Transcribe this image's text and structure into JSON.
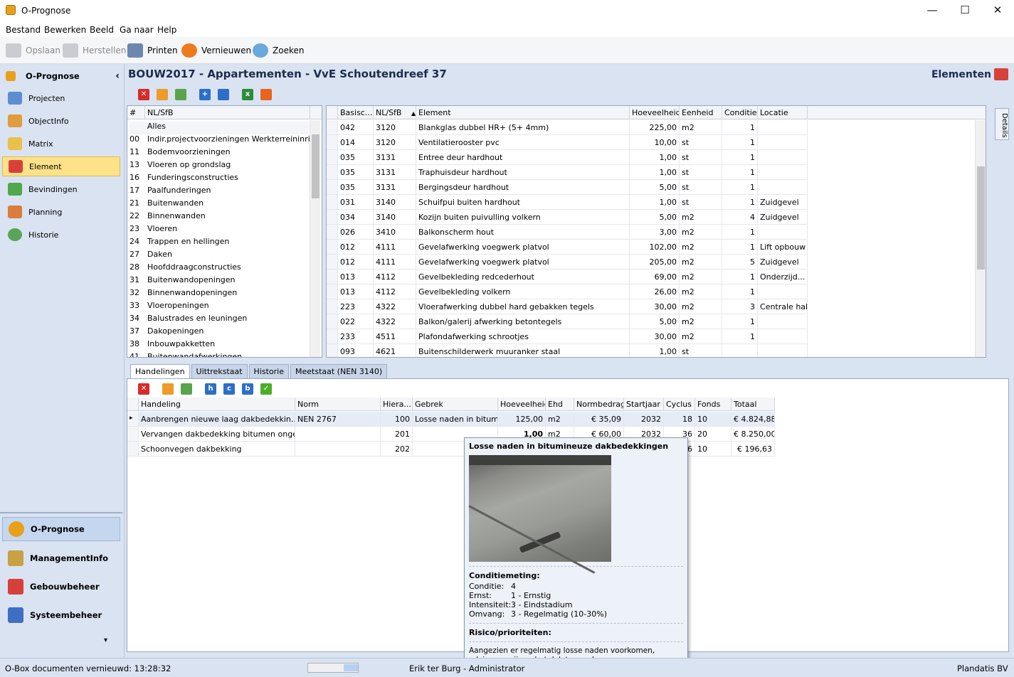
{
  "window": {
    "title": "O-Prognose",
    "min": "—",
    "max": "☐",
    "close": "✕"
  },
  "menu": [
    "Bestand",
    "Bewerken",
    "Beeld",
    "Ga naar",
    "Help"
  ],
  "toolbar": {
    "save": "Opslaan",
    "restore": "Herstellen",
    "print": "Printen",
    "refresh": "Vernieuwen",
    "search": "Zoeken"
  },
  "sidebar": {
    "header": "O-Prognose",
    "collapse": "‹",
    "items": [
      "Projecten",
      "ObjectInfo",
      "Matrix",
      "Element",
      "Bevindingen",
      "Planning",
      "Historie"
    ],
    "selected": "Element",
    "modules": [
      "O-Prognose",
      "ManagementInfo",
      "Gebouwbeheer",
      "Systeembeheer"
    ],
    "more": "▾"
  },
  "page": {
    "title": "BOUW2017 - Appartementen - VvE Schoutendreef 37",
    "section": "Elementen"
  },
  "nlsfb": {
    "headers": [
      "#",
      "NL/SfB"
    ],
    "rows": [
      [
        "",
        "Alles"
      ],
      [
        "00",
        "Indir.projectvoorzieningen Werkterreininrich..."
      ],
      [
        "11",
        "Bodemvoorzieningen"
      ],
      [
        "13",
        "Vloeren op grondslag"
      ],
      [
        "16",
        "Funderingsconstructies"
      ],
      [
        "17",
        "Paalfunderingen"
      ],
      [
        "21",
        "Buitenwanden"
      ],
      [
        "22",
        "Binnenwanden"
      ],
      [
        "23",
        "Vloeren"
      ],
      [
        "24",
        "Trappen en hellingen"
      ],
      [
        "27",
        "Daken"
      ],
      [
        "28",
        "Hoofddraagconstructies"
      ],
      [
        "31",
        "Buitenwandopeningen"
      ],
      [
        "32",
        "Binnenwandopeningen"
      ],
      [
        "33",
        "Vloeropeningen"
      ],
      [
        "34",
        "Balustrades en leuningen"
      ],
      [
        "37",
        "Dakopeningen"
      ],
      [
        "38",
        "Inbouwpakketten"
      ],
      [
        "41",
        "Buitenwandafwerkingen"
      ]
    ]
  },
  "elements": {
    "headers": [
      "Basisc...",
      "NL/SfB",
      "Element",
      "Hoeveelheid",
      "Eenheid",
      "Conditie",
      "Locatie"
    ],
    "sort_indicator": "▲",
    "rows": [
      [
        "042",
        "3120",
        "Blankglas dubbel HR+ (5+ 4mm)",
        "225,00",
        "m2",
        "1",
        ""
      ],
      [
        "014",
        "3120",
        "Ventilatierooster pvc",
        "10,00",
        "st",
        "1",
        ""
      ],
      [
        "035",
        "3131",
        "Entree deur hardhout",
        "1,00",
        "st",
        "1",
        ""
      ],
      [
        "035",
        "3131",
        "Traphuisdeur hardhout",
        "1,00",
        "st",
        "1",
        ""
      ],
      [
        "035",
        "3131",
        "Bergingsdeur hardhout",
        "5,00",
        "st",
        "1",
        ""
      ],
      [
        "031",
        "3140",
        "Schuifpui buiten hardhout",
        "1,00",
        "st",
        "1",
        "Zuidgevel"
      ],
      [
        "034",
        "3140",
        "Kozijn buiten puivulling volkern",
        "5,00",
        "m2",
        "4",
        "Zuidgevel"
      ],
      [
        "026",
        "3410",
        "Balkonscherm hout",
        "3,00",
        "m2",
        "1",
        ""
      ],
      [
        "012",
        "4111",
        "Gevelafwerking voegwerk platvol",
        "102,00",
        "m2",
        "1",
        "Lift opbouw"
      ],
      [
        "012",
        "4111",
        "Gevelafwerking voegwerk platvol",
        "205,00",
        "m2",
        "5",
        "Zuidgevel"
      ],
      [
        "013",
        "4112",
        "Gevelbekleding redcederhout",
        "69,00",
        "m2",
        "1",
        "Onderzijd..."
      ],
      [
        "013",
        "4112",
        "Gevelbekleding volkern",
        "26,00",
        "m2",
        "1",
        ""
      ],
      [
        "223",
        "4322",
        "Vloerafwerking dubbel hard gebakken tegels",
        "30,00",
        "m2",
        "3",
        "Centrale hal"
      ],
      [
        "022",
        "4322",
        "Balkon/galerij afwerking betontegels",
        "5,00",
        "m2",
        "1",
        ""
      ],
      [
        "233",
        "4511",
        "Plafondafwerking schrootjes",
        "30,00",
        "m2",
        "1",
        ""
      ],
      [
        "093",
        "4621",
        "Buitenschilderwerk muuranker staal",
        "1,00",
        "st",
        "",
        ""
      ]
    ],
    "details_tab": "Details"
  },
  "bottom_tabs": [
    "Handelingen",
    "Uittrekstaat",
    "Historie",
    "Meetstaat (NEN 3140)"
  ],
  "bottom_active": "Handelingen",
  "handelingen": {
    "headers": [
      "Handeling",
      "Norm",
      "Hiera...",
      "Gebrek",
      "Hoeveelheid",
      "Ehd",
      "Normbedrag",
      "Startjaar",
      "Cyclus",
      "Fonds",
      "Totaal"
    ],
    "rows": [
      [
        "Aanbrengen nieuwe laag dakbedekkin...",
        "NEN 2767",
        "100",
        "Losse naden in bitum...",
        "125,00",
        "m2",
        "€ 35,09",
        "2032",
        "18",
        "10",
        "€ 4.824,88"
      ],
      [
        "Vervangen dakbedekking bitumen ongeba...",
        "",
        "201",
        "",
        "1,00",
        "m2",
        "€ 60,00",
        "2032",
        "36",
        "20",
        "€ 8.250,00"
      ],
      [
        "Schoonvegen dakbekking",
        "",
        "202",
        "",
        "",
        "",
        "",
        "",
        "6",
        "10",
        "€ 196,63"
      ]
    ],
    "current_marker": "▸"
  },
  "tooltip": {
    "title": "Losse naden in bitumineuze dakbedekkingen",
    "cond_title": "Conditiemeting:",
    "cond": [
      [
        "Conditie:",
        "4"
      ],
      [
        "Ernst:",
        "1 - Ernstig"
      ],
      [
        "Intensiteit:",
        "3 - Eindstadium"
      ],
      [
        "Omvang:",
        "3 - Regelmatig (10-30%)"
      ]
    ],
    "risk_title": "Risico/prioriteiten:",
    "advice": "Aangezien er regelmatig losse naden voorkomen, adviseren wij om het dak te overlagen."
  },
  "status": {
    "left": "O-Box documenten vernieuwd: 13:28:32",
    "user": "Erik ter Burg - Administrator",
    "company": "Plandatis BV"
  }
}
